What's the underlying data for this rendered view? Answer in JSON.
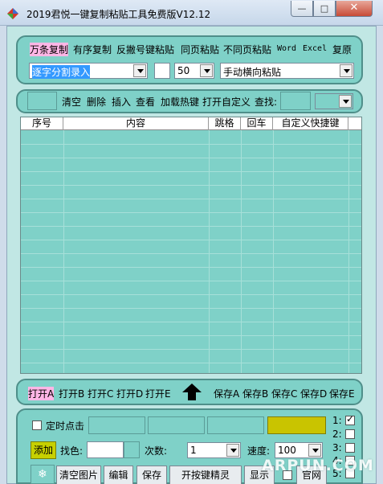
{
  "window": {
    "title": "2019君悦一键复制粘贴工具免费版V12.12",
    "min_glyph": "—",
    "max_glyph": "□",
    "close_glyph": "✕"
  },
  "top_panel": {
    "tabs": [
      "万条复制",
      "有序复制",
      "反撇号键粘贴",
      "同页粘贴",
      "不同页粘贴",
      "Word",
      "Excel",
      "复原"
    ],
    "mode_select": "逐字分割录入",
    "count_select": "50",
    "paste_select": "手动横向粘贴"
  },
  "toolbar": {
    "items": [
      "清空",
      "删除",
      "插入",
      "查看",
      "加载热键",
      "打开自定义",
      "查找:"
    ]
  },
  "table": {
    "columns": [
      "序号",
      "内容",
      "跳格",
      "回车",
      "自定义快捷键"
    ]
  },
  "bottom_bar": {
    "open_items": [
      "打开A",
      "打开B",
      "打开C",
      "打开D",
      "打开E"
    ],
    "save_items": [
      "保存A",
      "保存B",
      "保存C",
      "保存D",
      "保存E"
    ]
  },
  "controls": {
    "timed_click": "定时点击",
    "add_label": "添加",
    "color_label": "找色:",
    "times_label": "次数:",
    "times_value": "1",
    "speed_label": "速度:",
    "speed_value": "100",
    "slots": [
      "1:",
      "2:",
      "3:",
      "4:",
      "5:"
    ],
    "buttons": [
      "清空图片",
      "编辑",
      "保存",
      "开按键精灵",
      "显示",
      "官网"
    ]
  },
  "watermark": "ARPUN.COM",
  "colors": {
    "panel": "#7fd1c8",
    "highlight": "#ffb6e6",
    "accent_yellow": "#c9c400"
  }
}
